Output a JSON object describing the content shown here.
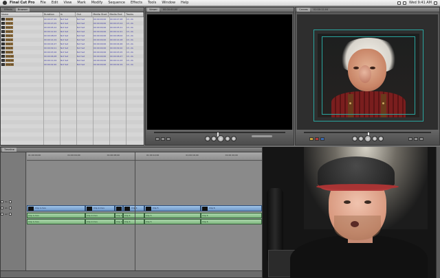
{
  "menubar": {
    "app_name": "Final Cut Pro",
    "items": [
      "File",
      "Edit",
      "View",
      "Mark",
      "Modify",
      "Sequence",
      "Effects",
      "Tools",
      "Window",
      "Help"
    ],
    "clock": "Wed 9:41 AM"
  },
  "browser": {
    "tab": "Effects",
    "tab2": "Browser",
    "columns": [
      "Name",
      "Duration",
      "In",
      "Out",
      "Media Start",
      "Media End",
      "Tracks"
    ],
    "clips": [
      "Clip 1",
      "Clip 2",
      "Clip 3",
      "Clip 4",
      "Clip 5",
      "Clip 6",
      "Clip 7",
      "Clip 8",
      "Clip 9",
      "Clip 10",
      "Clip 11",
      "Clip 12"
    ],
    "durations": [
      "00:00:27;29",
      "00:00:23;15",
      "00:00:05;12",
      "00:00:12;22",
      "00:00:08;03",
      "00:00:14;19",
      "00:00:04;27",
      "00:00:09;11",
      "00:00:03;16",
      "00:00:06;28",
      "00:00:11;04",
      "00:00:02;20"
    ],
    "ins": [
      "Not Set",
      "Not Set",
      "Not Set",
      "Not Set",
      "Not Set",
      "Not Set",
      "Not Set",
      "Not Set",
      "Not Set",
      "Not Set",
      "Not Set",
      "Not Set"
    ],
    "outs": [
      "Not Set",
      "Not Set",
      "Not Set",
      "Not Set",
      "Not Set",
      "Not Set",
      "Not Set",
      "Not Set",
      "Not Set",
      "Not Set",
      "Not Set",
      "Not Set"
    ],
    "starts": [
      "00:00:00;00",
      "00:00:00;00",
      "00:00:00;00",
      "00:00:00;00",
      "00:00:00;00",
      "00:00:00;00",
      "00:00:00;00",
      "00:00:00;00",
      "00:00:00;00",
      "00:00:00;00",
      "00:00:00;00",
      "00:00:00;00"
    ],
    "ends": [
      "00:00:27;28",
      "00:00:23;14",
      "00:00:05;11",
      "00:00:12;21",
      "00:00:08;02",
      "00:00:14;18",
      "00:00:04;26",
      "00:00:09;10",
      "00:00:03;15",
      "00:00:06;27",
      "00:00:11;03",
      "00:00:02;19"
    ],
    "tracks": [
      "1V, 2A",
      "1V, 2A",
      "1V, 2A",
      "1V, 2A",
      "1V, 2A",
      "1V, 2A",
      "1V, 2A",
      "1V, 2A",
      "1V, 2A",
      "1V, 2A",
      "1V, 2A",
      "1V, 2A"
    ]
  },
  "viewer": {
    "tab": "Viewer",
    "timecode": "00:00:00;00"
  },
  "canvas": {
    "tab": "Canvas",
    "timecode": "01:00:12;04",
    "scrub_position": 0.5
  },
  "timeline": {
    "tab": "Timeline",
    "ruler": [
      "01:00:00;00",
      "01:00:04;00",
      "01:00:08;00",
      "01:00:12;00",
      "01:00:16;00",
      "01:00:20;00"
    ],
    "tracks": [
      "V1",
      "A1",
      "A2"
    ],
    "video_clips": [
      {
        "label": "Clip 1.mov",
        "start": 0,
        "end": 85
      },
      {
        "label": "Clip 2.mov",
        "start": 85,
        "end": 128
      },
      {
        "label": "Clip 3",
        "start": 128,
        "end": 140
      },
      {
        "label": "Clip 4",
        "start": 140,
        "end": 171
      },
      {
        "label": "Clip 5",
        "start": 171,
        "end": 253
      },
      {
        "label": "Clip 6",
        "start": 253,
        "end": 342
      }
    ],
    "audio_labels": [
      "Clip 1.mov",
      "Clip 2.mov",
      "Clip 3",
      "Clip 4",
      "Clip 5",
      "Clip 6"
    ]
  },
  "colors": {
    "accent": "#2aa6a0",
    "video_clip": "#7ea8d8",
    "audio_clip": "#8fc48f"
  }
}
